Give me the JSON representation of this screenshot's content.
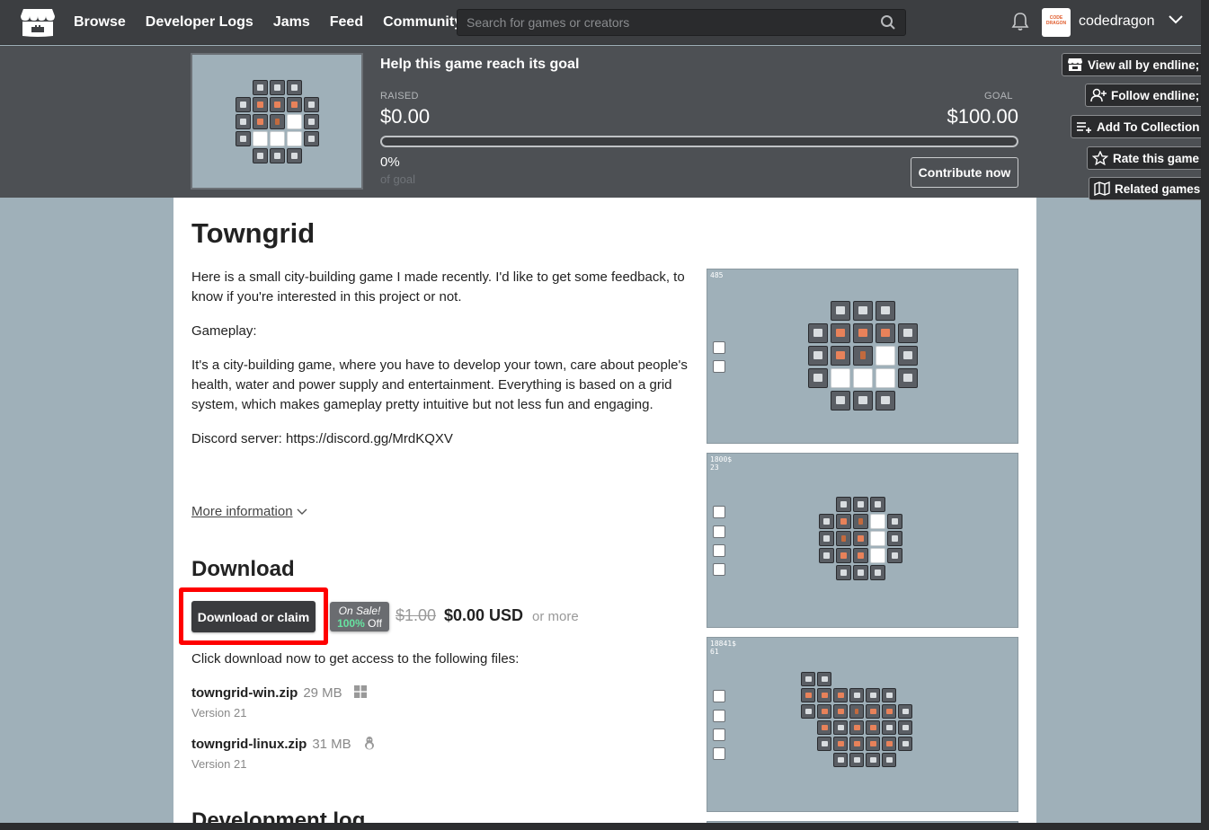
{
  "nav": {
    "items": [
      "Browse",
      "Developer Logs",
      "Jams",
      "Feed",
      "Community"
    ],
    "search_placeholder": "Search for games or creators",
    "username": "codedragon",
    "avatar_text": "CODE DRAGON"
  },
  "banner": {
    "title": "Help this game reach its goal",
    "raised_label": "RAISED",
    "raised_value": "$0.00",
    "goal_label": "GOAL",
    "goal_value": "$100.00",
    "progress_fraction": 0,
    "percent": "0%",
    "of_goal": "of goal",
    "contribute_label": "Contribute now"
  },
  "side_actions": [
    {
      "label": "View all by endline;",
      "icon": "store-icon"
    },
    {
      "label": "Follow endline;",
      "icon": "add-user-icon"
    },
    {
      "label": "Add To Collection",
      "icon": "add-list-icon"
    },
    {
      "label": "Rate this game",
      "icon": "star-icon"
    },
    {
      "label": "Related games",
      "icon": "map-icon"
    }
  ],
  "game": {
    "title": "Towngrid",
    "description": [
      "Here is a small city-building game I made recently. I'd like to get some feedback, to know if you're interested in this project or not.",
      "Gameplay:",
      "It's a city-building game, where you have to develop your town, care about people's health, water and power supply and entertainment. Everything is based on a grid system, which makes gameplay pretty intuitive but not less fun and engaging."
    ],
    "discord_label": "Discord server: ",
    "discord_link": "https://discord.gg/MrdKQXV",
    "more_info": "More information"
  },
  "download": {
    "heading": "Download",
    "button_label": "Download or claim",
    "sale_label": "On Sale!",
    "sale_percent": "100%",
    "sale_off": "Off",
    "old_price": "$1.00",
    "new_price": "$0.00 USD",
    "or_more": "or more",
    "note": "Click download now to get access to the following files:",
    "files": [
      {
        "name": "towngrid-win.zip",
        "size": "29 MB",
        "platform_icon": "windows-icon",
        "version": "Version 21"
      },
      {
        "name": "towngrid-linux.zip",
        "size": "31 MB",
        "platform_icon": "linux-icon",
        "version": "Version 21"
      }
    ]
  },
  "devlog_heading": "Development log",
  "screenshots": [
    {
      "hud": [
        "485"
      ]
    },
    {
      "hud": [
        "1800$",
        "23"
      ]
    },
    {
      "hud": [
        "18841$",
        "61"
      ]
    }
  ]
}
